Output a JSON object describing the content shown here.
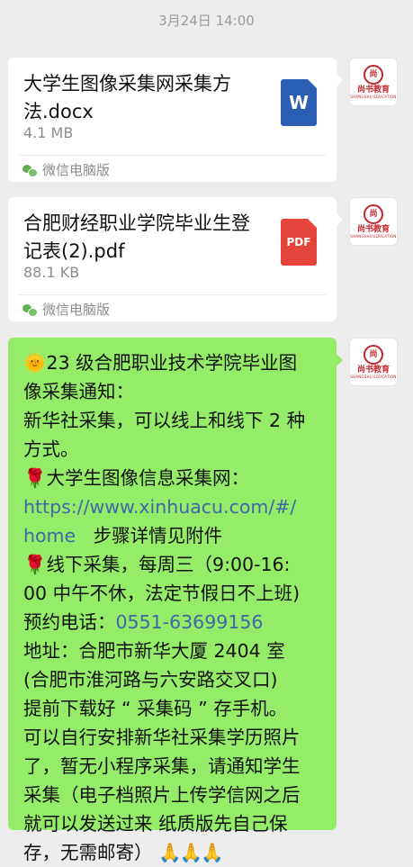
{
  "timestamp": "3月24日 14:00",
  "avatar": {
    "seal": "尚",
    "brand": "尚书教育",
    "brand_en": "SHANGSHU EDUCATION"
  },
  "messages": [
    {
      "file_name": "大学生图像采集网采集方法.docx",
      "file_size": "4.1 MB",
      "file_type_label": "W",
      "file_icon": "word-document-icon",
      "source": "微信电脑版"
    },
    {
      "file_name": "合肥财经职业学院毕业生登记表(2).pdf",
      "file_size": "88.1 KB",
      "file_type_label": "PDF",
      "file_icon": "pdf-document-icon",
      "source": "微信电脑版"
    }
  ],
  "text_message": {
    "emoji_sun": "🌞",
    "emoji_rose": "🌹",
    "emoji_hands": "🙏🙏🙏",
    "line1": "23 级合肥职业技术学院毕业图",
    "line2": "像采集通知：",
    "line3": "新华社采集，可以线上和线下 2 种",
    "line4": "方式。",
    "line5": "大学生图像信息采集网：",
    "link_part1": "https://www.xinhuacu.com/#/",
    "link_part2": "home",
    "line7_rest": "   步骤详情见附件",
    "line8": "线下采集，每周三（9:00-16:",
    "line9": "00 中午不休，法定节假日不上班)",
    "phone_label": "预约电话：",
    "phone": "0551-63699156",
    "line11": "地址：合肥市新华大厦 2404 室",
    "line12": "(合肥市淮河路与六安路交叉口)",
    "line13": "提前下载好 “ 采集码 ” 存手机。",
    "line14": "可以自行安排新华社采集学历照片",
    "line15": "了，暂无小程序采集，请通知学生",
    "line16": "采集（电子档照片上传学信网之后",
    "line17": "就可以发送过来 纸质版先自己保",
    "line18": "存，无需邮寄）"
  }
}
